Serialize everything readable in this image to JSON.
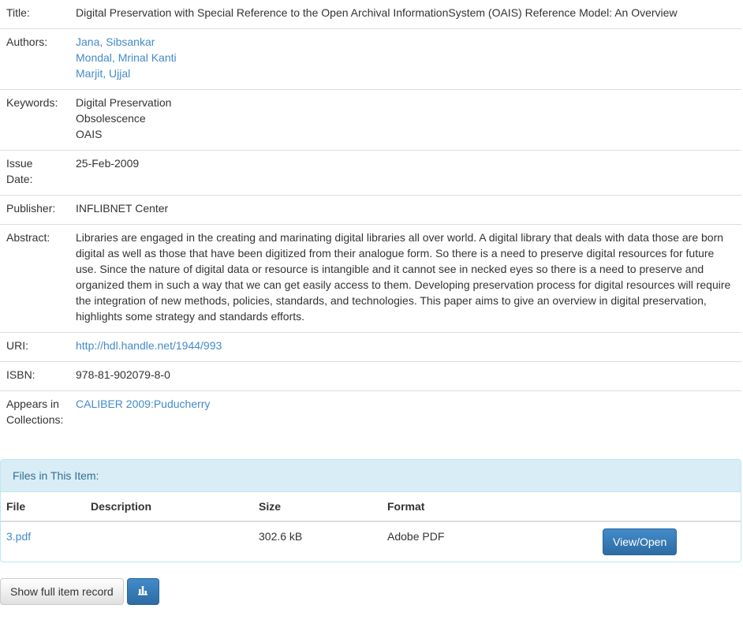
{
  "item": {
    "title_label": "Title:",
    "title": "Digital Preservation with Special Reference to the Open Archival InformationSystem (OAIS) Reference Model: An Overview",
    "authors_label": "Authors:",
    "authors": [
      "Jana, Sibsankar",
      "Mondal, Mrinal Kanti",
      "Marjit, Ujjal"
    ],
    "keywords_label": "Keywords:",
    "keywords": [
      "Digital Preservation",
      "Obsolescence",
      "OAIS"
    ],
    "issue_date_label_1": "Issue",
    "issue_date_label_2": "Date:",
    "issue_date": "25-Feb-2009",
    "publisher_label": "Publisher:",
    "publisher": "INFLIBNET Center",
    "abstract_label": "Abstract:",
    "abstract": "Libraries are engaged in the creating and marinating digital libraries all over world. A digital library that deals with data those are born digital as well as those that have been digitized from their analogue form. So there is a need to preserve digital resources for future use. Since the nature of digital data or resource is intangible and it cannot see in necked eyes so there is a need to preserve and organized them in such a way that we can get easily access to them. Developing preservation process for digital resources will require the integration of new methods, policies, standards, and technologies. This paper aims to give an overview in digital preservation, highlights some strategy and standards efforts.",
    "uri_label": "URI:",
    "uri": "http://hdl.handle.net/1944/993",
    "isbn_label": "ISBN:",
    "isbn": "978-81-902079-8-0",
    "collections_label_1": "Appears in",
    "collections_label_2": "Collections:",
    "collection": "CALIBER 2009:Puducherry"
  },
  "files": {
    "heading": "Files in This Item:",
    "columns": {
      "file": "File",
      "description": "Description",
      "size": "Size",
      "format": "Format"
    },
    "rows": [
      {
        "file": "3.pdf",
        "description": "",
        "size": "302.6 kB",
        "format": "Adobe PDF",
        "action": "View/Open"
      }
    ]
  },
  "actions": {
    "full_record": "Show full item record",
    "stats_icon": "bar-chart-icon"
  },
  "colors": {
    "link": "#428bca",
    "primary": "#2d6ca2",
    "panel_heading_bg": "#d9edf7",
    "panel_heading_text": "#31708f"
  }
}
